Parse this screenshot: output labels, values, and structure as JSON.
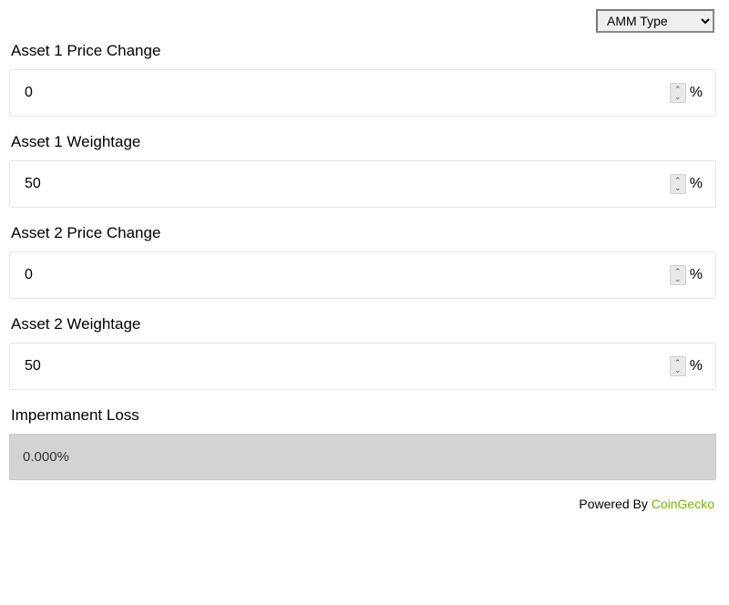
{
  "amm_type": {
    "selected": "AMM Type"
  },
  "fields": {
    "asset1_price": {
      "label": "Asset 1 Price Change",
      "value": "0",
      "unit": "%"
    },
    "asset1_weight": {
      "label": "Asset 1 Weightage",
      "value": "50",
      "unit": "%"
    },
    "asset2_price": {
      "label": "Asset 2 Price Change",
      "value": "0",
      "unit": "%"
    },
    "asset2_weight": {
      "label": "Asset 2 Weightage",
      "value": "50",
      "unit": "%"
    }
  },
  "result": {
    "label": "Impermanent Loss",
    "value": "0.000%"
  },
  "footer": {
    "prefix": "Powered By ",
    "link_text": "CoinGecko"
  }
}
